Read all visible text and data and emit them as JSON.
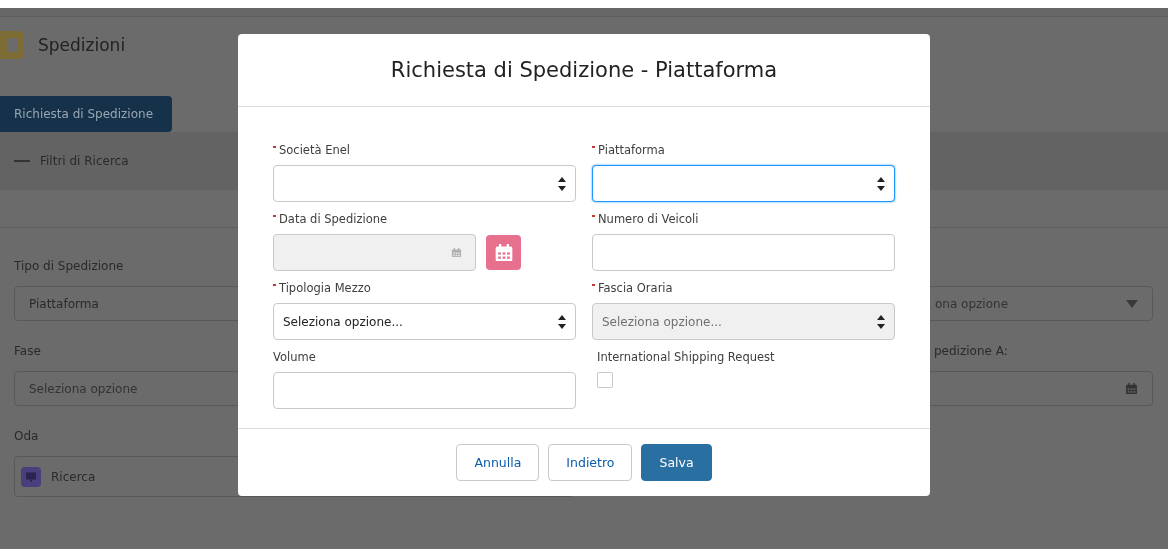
{
  "app": {
    "title": "Spedizioni",
    "new_request_button": "Richiesta di Spedizione",
    "filters_section": {
      "title": "Filtri di Ricerca",
      "expanded": true
    },
    "filters": [
      {
        "label": "Tipo di Spedizione",
        "value": "Piattaforma",
        "kind": "select"
      },
      {
        "label": "Fase",
        "placeholder": "Seleziona opzione",
        "kind": "select"
      },
      {
        "label": "Oda",
        "value": "Ricerca",
        "kind": "lookup"
      }
    ],
    "right_filters": [
      {
        "placeholder": "ona opzione",
        "kind": "select"
      },
      {
        "label": "pedizione A:",
        "kind": "date"
      }
    ]
  },
  "dialog": {
    "title": "Richiesta di Spedizione - Piattaforma",
    "fields": [
      {
        "label": "Società Enel",
        "required": true,
        "kind": "select",
        "disabled": false,
        "focused": false
      },
      {
        "label": "Piattaforma",
        "required": true,
        "kind": "select",
        "disabled": false,
        "focused": true
      },
      {
        "label": "Data di Spedizione",
        "required": true,
        "kind": "date",
        "disabled": true,
        "focused": false
      },
      {
        "label": "Numero di Veicoli",
        "required": true,
        "kind": "text",
        "disabled": false,
        "focused": false
      },
      {
        "label": "Tipologia Mezzo",
        "required": true,
        "kind": "select",
        "value": "Seleziona opzione...",
        "disabled": false,
        "focused": false
      },
      {
        "label": "Fascia Oraria",
        "required": true,
        "kind": "select",
        "value": "Seleziona opzione...",
        "disabled": true,
        "focused": false
      },
      {
        "label": "Volume",
        "required": false,
        "kind": "text",
        "disabled": false,
        "focused": false
      },
      {
        "label": "International Shipping Request",
        "required": false,
        "kind": "checkbox",
        "checked": false
      }
    ],
    "buttons": [
      {
        "label": "Annulla",
        "kind": "neutral"
      },
      {
        "label": "Indietro",
        "kind": "neutral"
      },
      {
        "label": "Salva",
        "kind": "brand"
      }
    ]
  }
}
